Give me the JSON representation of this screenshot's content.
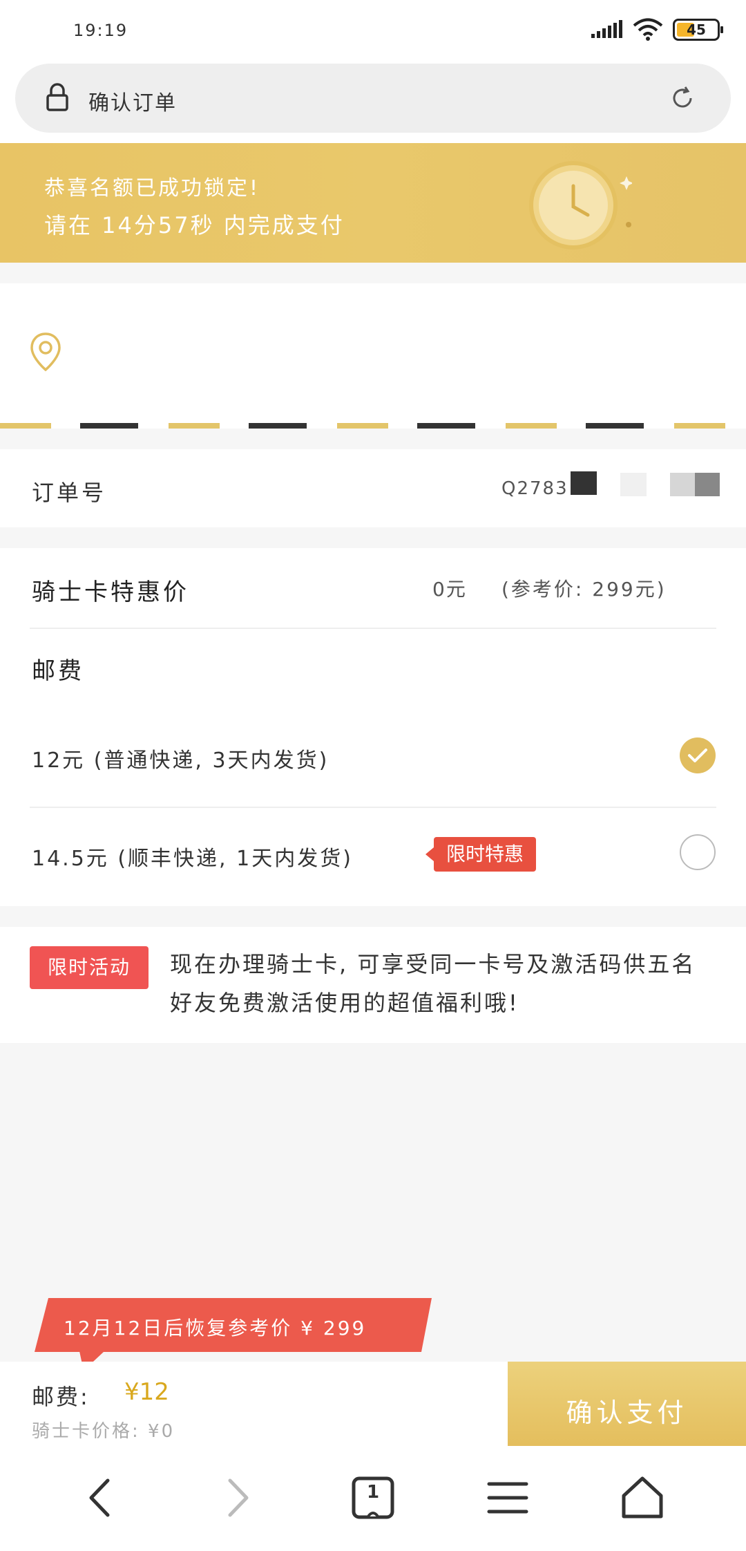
{
  "status_bar": {
    "time": "19:19",
    "battery": "45",
    "battery_level": 0.45
  },
  "address_bar": {
    "title": "确认订单"
  },
  "banner": {
    "line1": "恭喜名额已成功锁定!",
    "line2": "请在 14分57秒 内完成支付"
  },
  "order": {
    "label": "订单号",
    "number": "Q2783"
  },
  "knight_card": {
    "label": "骑士卡特惠价",
    "price": "0元",
    "reference": "(参考价: 299元)"
  },
  "postage": {
    "label": "邮费",
    "options": [
      {
        "text": "12元 (普通快递, 3天内发货)",
        "selected": true
      },
      {
        "text": "14.5元 (顺丰快递, 1天内发货)",
        "badge": "限时特惠",
        "selected": false
      }
    ]
  },
  "promo": {
    "badge": "限时活动",
    "text": "现在办理骑士卡, 可享受同一卡号及激活码供五名好友免费激活使用的超值福利哦!"
  },
  "ribbon": {
    "text": "12月12日后恢复参考价 ¥ 299"
  },
  "footer": {
    "postage_label": "邮费:",
    "postage_value": "¥12",
    "knight_price": "骑士卡价格: ¥0",
    "pay_button": "确认支付"
  },
  "browser_nav": {
    "tab_count": "1"
  },
  "colors": {
    "gold": "#e1bd5f",
    "red": "#e8503f",
    "banner": "#e8c465"
  }
}
